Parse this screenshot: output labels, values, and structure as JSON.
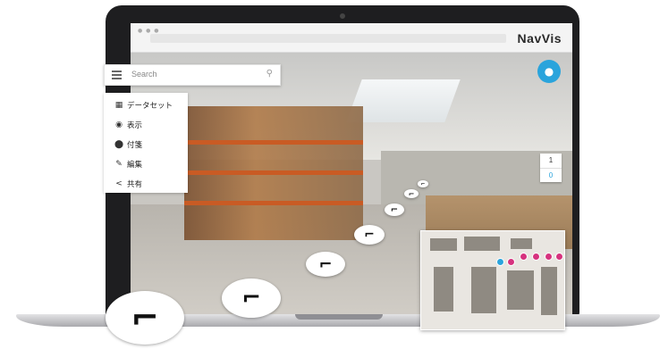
{
  "app": {
    "brand": "NavVis",
    "browser_dots": "● ● ●"
  },
  "search": {
    "placeholder": "Search"
  },
  "menu": {
    "items": [
      {
        "icon": "dataset-icon",
        "glyph": "▦",
        "label": "データセット"
      },
      {
        "icon": "eye-icon",
        "glyph": "◉",
        "label": "表示"
      },
      {
        "icon": "pin-icon",
        "glyph": "⬤",
        "label": "付箋"
      },
      {
        "icon": "pencil-icon",
        "glyph": "✎",
        "label": "編集"
      },
      {
        "icon": "share-icon",
        "glyph": "<",
        "label": "共有"
      }
    ]
  },
  "floors": {
    "upper": "1",
    "lower": "0"
  },
  "nav_arrow_glyph": "⌐",
  "colors": {
    "accent": "#2aa4dc",
    "poi": "#d6327e",
    "shelf_beam": "#c95b24"
  }
}
